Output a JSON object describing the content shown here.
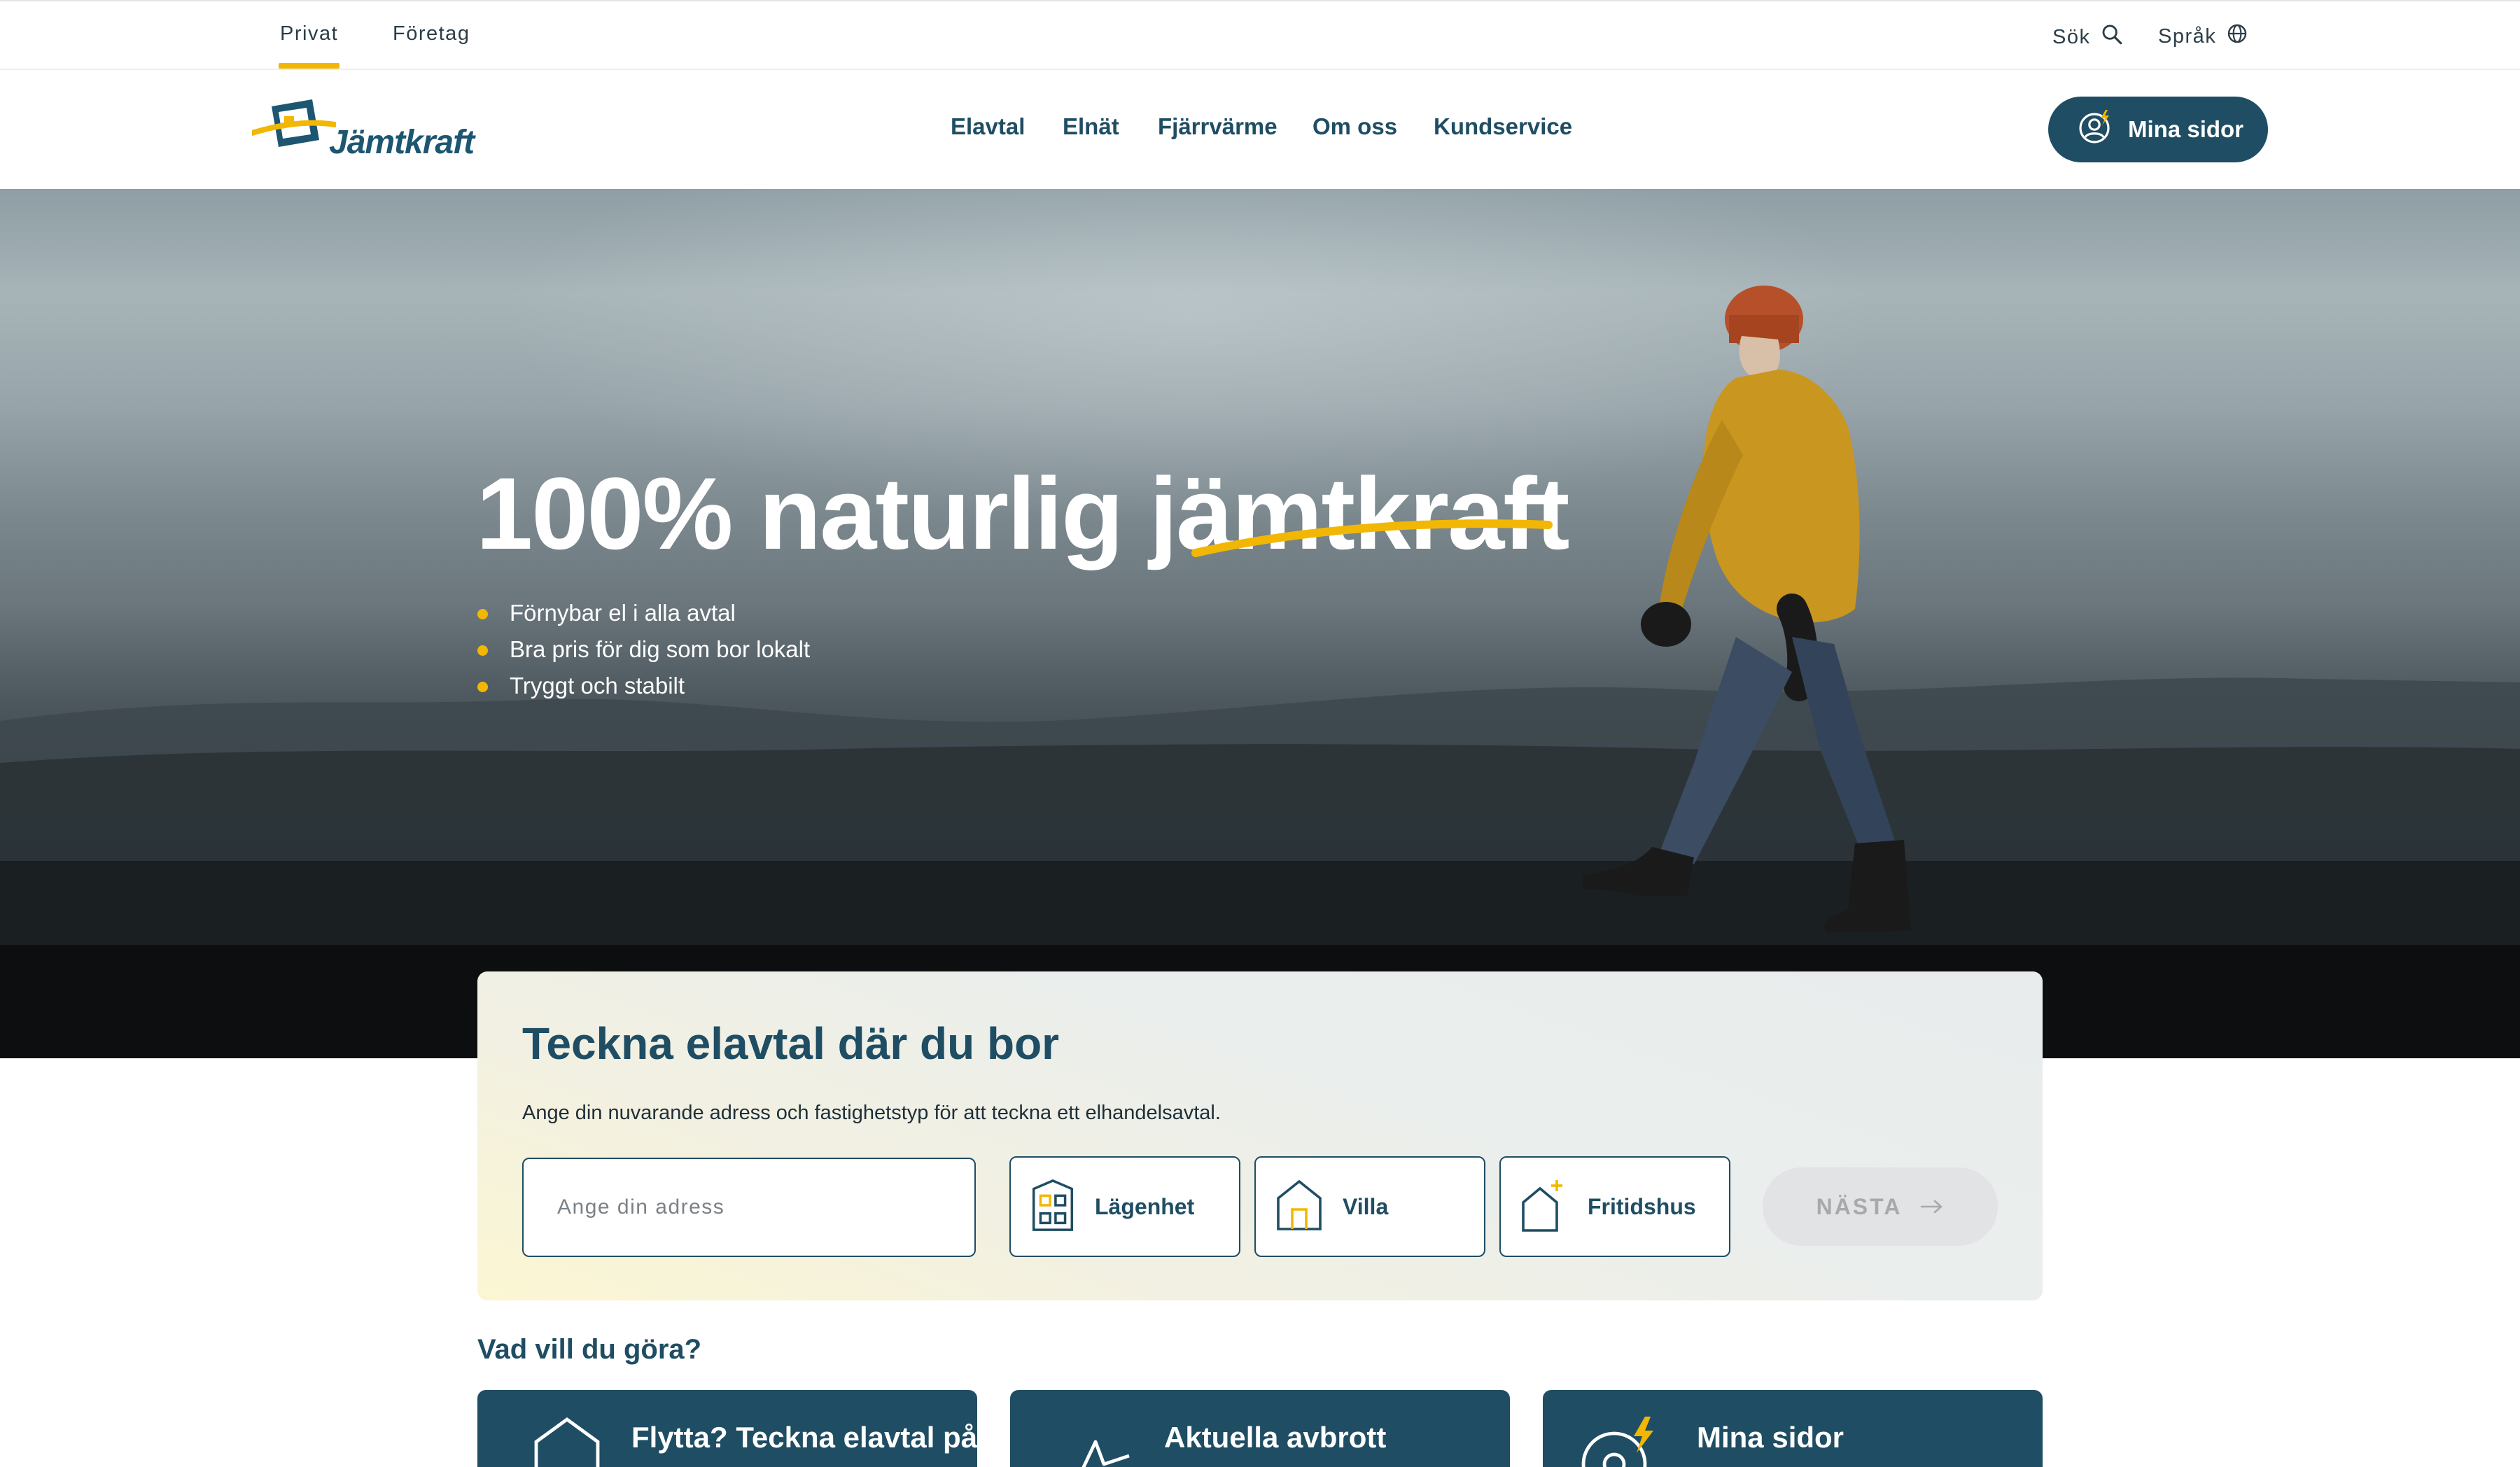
{
  "topbar": {
    "segments": [
      {
        "label": "Privat",
        "active": true
      },
      {
        "label": "Företag",
        "active": false
      }
    ],
    "search_label": "Sök",
    "language_label": "Språk"
  },
  "header": {
    "logo_text": "Jämtkraft",
    "nav": [
      "Elavtal",
      "Elnät",
      "Fjärrvärme",
      "Om oss",
      "Kundservice"
    ],
    "account_button": "Mina sidor"
  },
  "hero": {
    "headline": "100% naturlig jämtkraft",
    "bullets": [
      "Förnybar el i alla avtal",
      "Bra pris för dig som bor lokalt",
      "Tryggt och stabilt"
    ]
  },
  "signup": {
    "title": "Teckna elavtal där du bor",
    "description": "Ange din nuvarande adress och fastighetstyp för att teckna ett elhandelsavtal.",
    "address_placeholder": "Ange din adress",
    "address_value": "",
    "property_types": [
      "Lägenhet",
      "Villa",
      "Fritidshus"
    ],
    "next_button": "NÄSTA"
  },
  "actions": {
    "title": "Vad vill du göra?",
    "tiles": [
      "Flytta? Teckna elavtal på nya adressen",
      "Aktuella avbrott",
      "Mina sidor"
    ]
  },
  "colors": {
    "brand_blue": "#1f4d63",
    "accent_yellow": "#f2b705",
    "disabled_gray": "#e2e3e4"
  },
  "icons": {
    "search": "search-icon",
    "language": "globe-icon",
    "account": "user-bolt-icon",
    "apartment": "apartment-icon",
    "villa": "house-icon",
    "cottage": "cottage-icon",
    "arrow": "arrow-right-icon"
  }
}
